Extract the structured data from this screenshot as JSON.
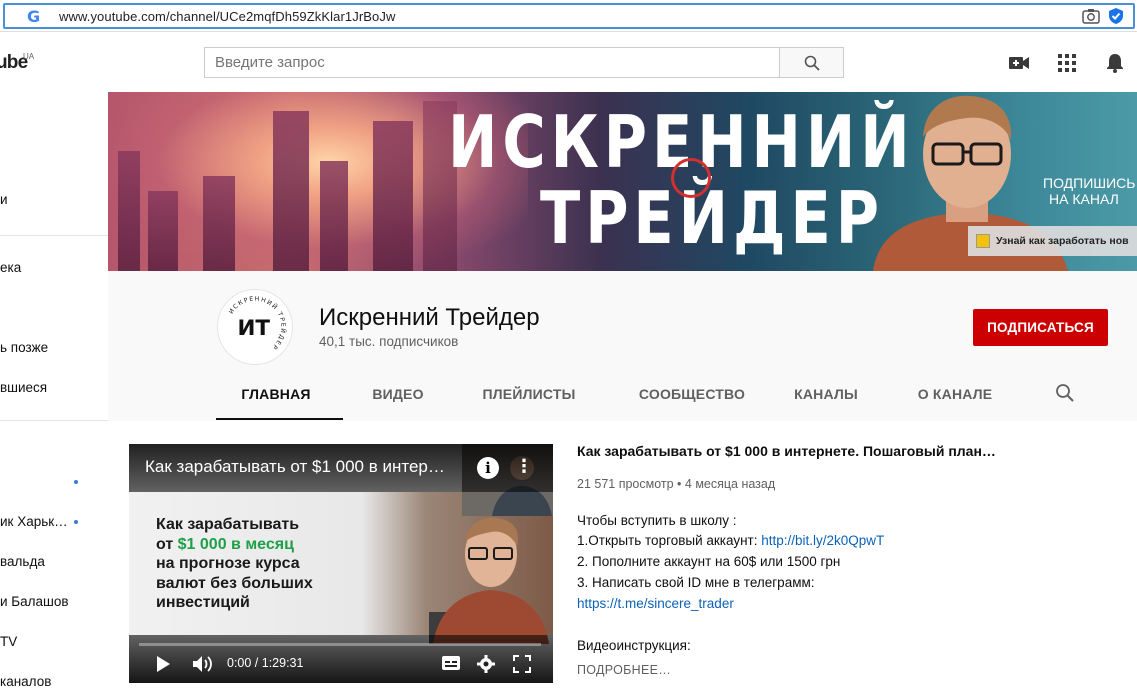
{
  "browser": {
    "url": "www.youtube.com/channel/UCe2mqfDh59ZkKlar1JrBoJw"
  },
  "header": {
    "logo_text": "ube",
    "logo_region": "UA",
    "search_placeholder": "Введите запрос",
    "icons": [
      "video-camera-icon",
      "apps-grid-icon",
      "bell-icon"
    ]
  },
  "sidebar": {
    "items": [
      {
        "label": "и"
      },
      {
        "label": "ека"
      },
      {
        "label": "ь позже"
      },
      {
        "label": "вшиеся"
      },
      {
        "label": "ик Харьк…"
      },
      {
        "label": "вальда"
      },
      {
        "label": "и Балашов"
      },
      {
        "label": "TV"
      },
      {
        "label": "каналов"
      }
    ]
  },
  "banner": {
    "title_line1": "ИСКРЕННИЙ",
    "title_line2": "ТРЕЙДЕР",
    "subscribe_text_line1": "ПОДПИШИСЬ",
    "subscribe_text_line2": "НА КАНАЛ",
    "link_text": "Узнай как заработать нов"
  },
  "channel": {
    "avatar_text": "ИТ",
    "avatar_ring_text": "ИСКРЕННИЙ ТРЕЙДЕР",
    "name": "Искренний Трейдер",
    "subscribers": "40,1 тыс. подписчиков",
    "subscribe_button": "ПОДПИСАТЬСЯ",
    "tabs": [
      {
        "label": "ГЛАВНАЯ",
        "active": true
      },
      {
        "label": "ВИДЕО",
        "active": false
      },
      {
        "label": "ПЛЕЙЛИСТЫ",
        "active": false
      },
      {
        "label": "СООБЩЕСТВО",
        "active": false
      },
      {
        "label": "КАНАЛЫ",
        "active": false
      },
      {
        "label": "О КАНАЛЕ",
        "active": false
      }
    ]
  },
  "video": {
    "player_title": "Как зарабатывать от $1 000 в интер…",
    "thumb_line1": "Как зарабатывать",
    "thumb_line2_prefix": "от ",
    "thumb_line2_green": "$1 000 в месяц",
    "thumb_line3": "на прогнозе курса",
    "thumb_line4": "валют без больших",
    "thumb_line5": "инвестиций",
    "time": "0:00 / 1:29:31",
    "progress": 0.0,
    "accent_color": "#ff0000",
    "green_color": "#1ea049"
  },
  "description": {
    "title": "Как зарабатывать от $1 000 в интернете. Пошаговый план…",
    "meta": "21 571 просмотр • 4 месяца назад",
    "line1": "Чтобы вступить в школу :",
    "line2_prefix": "1.Открыть торговый аккаунт: ",
    "line2_link": "http://bit.ly/2k0QpwT",
    "line3": "2. Пополните аккаунт на 60$ или 1500 грн",
    "line4": "3. Написать свой ID мне в телеграмм:",
    "line5_link": "https://t.me/sincere_trader",
    "line6": "Видеоинструкция:",
    "more": "ПОДРОБНЕЕ…"
  }
}
